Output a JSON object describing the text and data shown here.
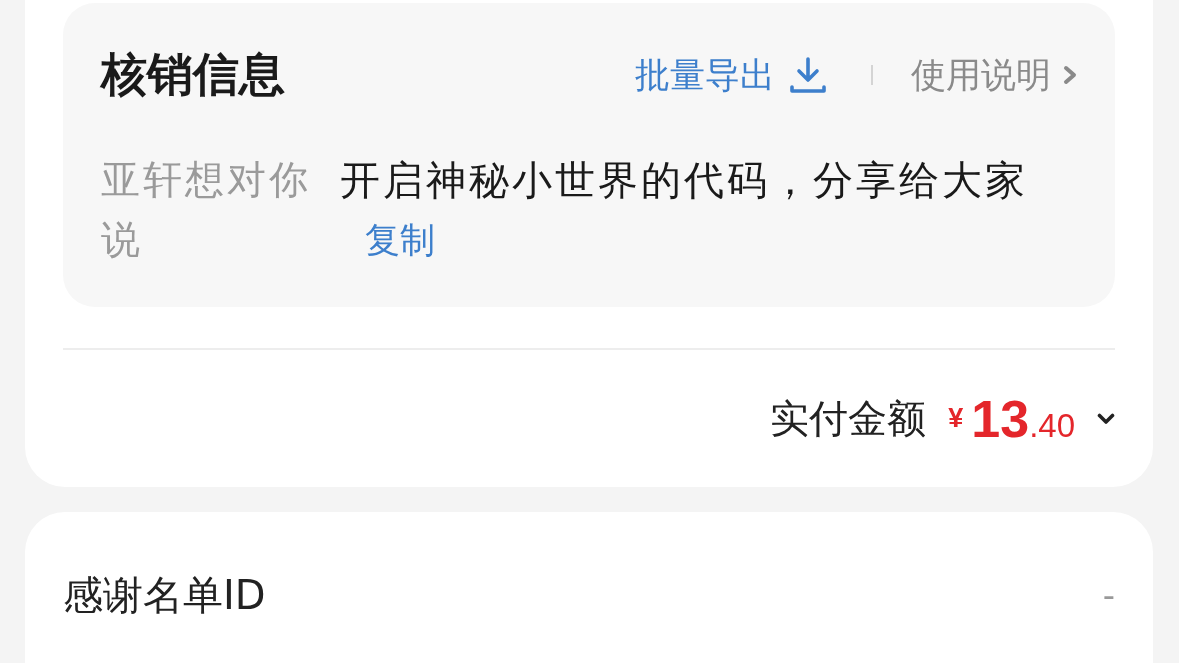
{
  "verification_panel": {
    "title": "核销信息",
    "export_action": {
      "label": "批量导出"
    },
    "help_link": {
      "label": "使用说明"
    },
    "fields": [
      {
        "label": "亚轩想对你说",
        "value": "开启神秘小世界的代码，分享给大家",
        "action": "复制"
      }
    ]
  },
  "payment": {
    "label": "实付金额",
    "currency": "¥",
    "amount_integer": "13",
    "amount_decimal": ".40",
    "expanded": false
  },
  "thanks_list": {
    "label": "感谢名单ID",
    "value": "-"
  }
}
